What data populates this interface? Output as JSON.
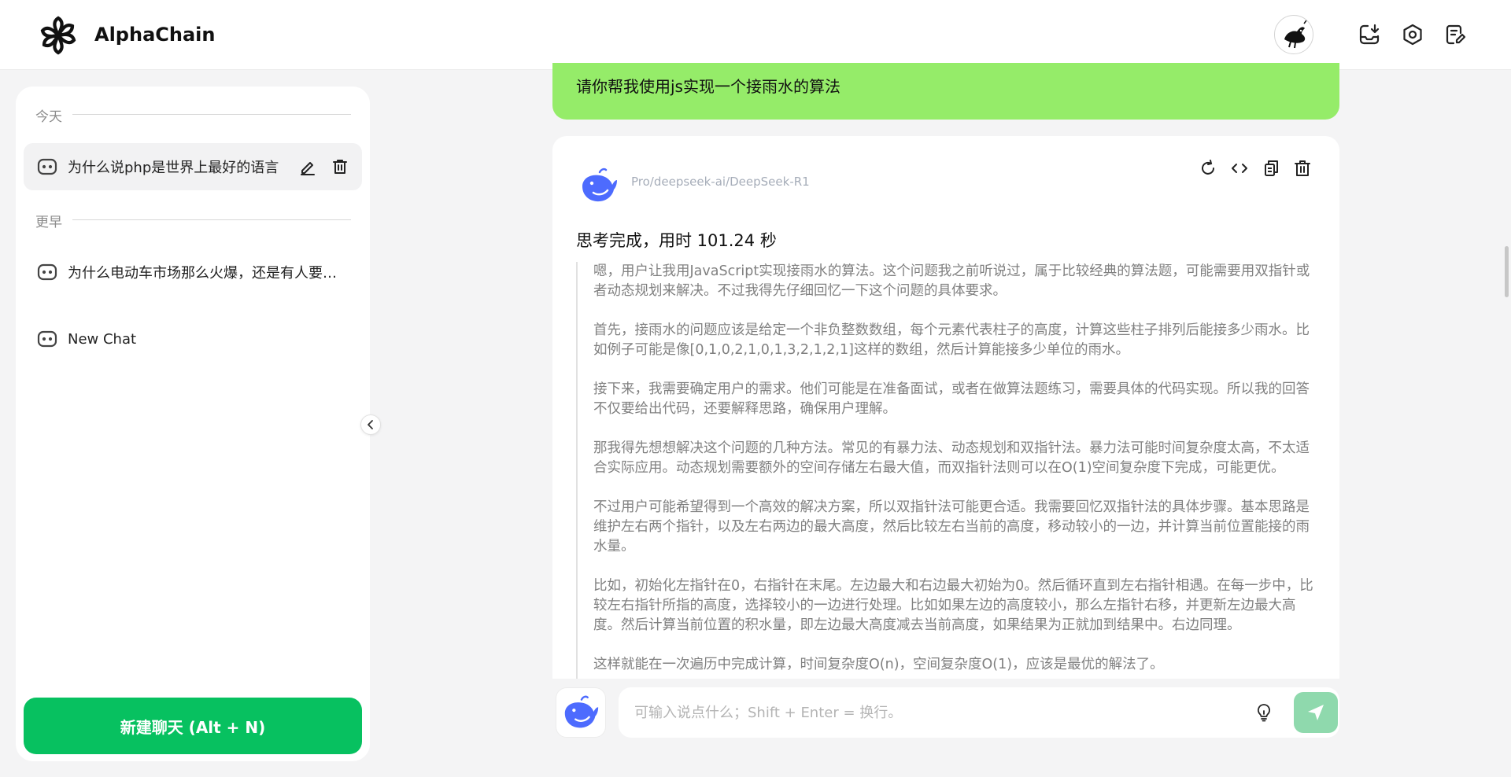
{
  "app": {
    "name": "AlphaChain",
    "accent_color": "#07c160",
    "user_bubble_color": "#95ec69"
  },
  "header": {
    "icons": [
      "avatar",
      "download-icon",
      "settings-icon",
      "notes-icon"
    ]
  },
  "sidebar": {
    "today_label": "今天",
    "earlier_label": "更早",
    "today_items": [
      {
        "label": "为什么说php是世界上最好的语言",
        "active": true
      }
    ],
    "earlier_items": [
      {
        "label": "为什么电动车市场那么火爆，还是有人要买燃油车？"
      },
      {
        "label": "New Chat"
      }
    ],
    "new_chat_label": "新建聊天 (Alt + N)"
  },
  "chat": {
    "user_message": "请你帮我使用js实现一个接雨水的算法",
    "bot": {
      "model": "Pro/deepseek-ai/DeepSeek-R1",
      "think_title": "思考完成，用时 101.24 秒",
      "paragraphs": [
        "嗯，用户让我用JavaScript实现接雨水的算法。这个问题我之前听说过，属于比较经典的算法题，可能需要用双指针或者动态规划来解决。不过我得先仔细回忆一下这个问题的具体要求。",
        "首先，接雨水的问题应该是给定一个非负整数数组，每个元素代表柱子的高度，计算这些柱子排列后能接多少雨水。比如例子可能是像[0,1,0,2,1,0,1,3,2,1,2,1]这样的数组，然后计算能接多少单位的雨水。",
        "接下来，我需要确定用户的需求。他们可能是在准备面试，或者在做算法题练习，需要具体的代码实现。所以我的回答不仅要给出代码，还要解释思路，确保用户理解。",
        "那我得先想想解决这个问题的几种方法。常见的有暴力法、动态规划和双指针法。暴力法可能时间复杂度太高，不太适合实际应用。动态规划需要额外的空间存储左右最大值，而双指针法则可以在O(1)空间复杂度下完成，可能更优。",
        "不过用户可能希望得到一个高效的解决方案，所以双指针法可能更合适。我需要回忆双指针法的具体步骤。基本思路是维护左右两个指针，以及左右两边的最大高度，然后比较左右当前的高度，移动较小的一边，并计算当前位置能接的雨水量。",
        "比如，初始化左指针在0，右指针在末尾。左边最大和右边最大初始为0。然后循环直到左右指针相遇。在每一步中，比较左右指针所指的高度，选择较小的一边进行处理。比如如果左边的高度较小，那么左指针右移，并更新左边最大高度。然后计算当前位置的积水量，即左边最大高度减去当前高度，如果结果为正就加到结果中。右边同理。",
        "这样就能在一次遍历中完成计算，时间复杂度O(n)，空间复杂度O(1)，应该是最优的解法了。"
      ]
    }
  },
  "input": {
    "placeholder": "可输入说点什么；Shift + Enter = 换行。",
    "value": ""
  }
}
